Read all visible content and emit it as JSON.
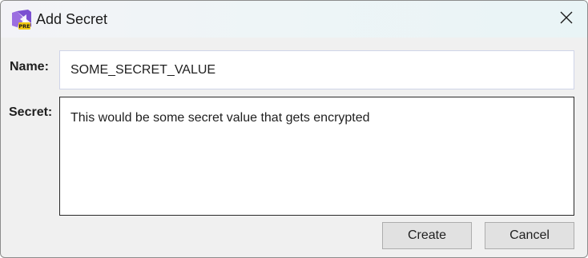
{
  "window": {
    "title": "Add Secret",
    "app_icon": "visual-studio-preview-icon",
    "close_icon": "close-icon"
  },
  "form": {
    "name_label": "Name:",
    "name_value": "SOME_SECRET_VALUE",
    "secret_label": "Secret:",
    "secret_value": "This would be some secret value that gets encrypted"
  },
  "buttons": {
    "create_label": "Create",
    "cancel_label": "Cancel"
  },
  "colors": {
    "icon_purple": "#7b4fd1",
    "icon_badge": "#f2c811",
    "button_bg": "#e1e1e1",
    "window_bg": "#f0f0f0"
  }
}
